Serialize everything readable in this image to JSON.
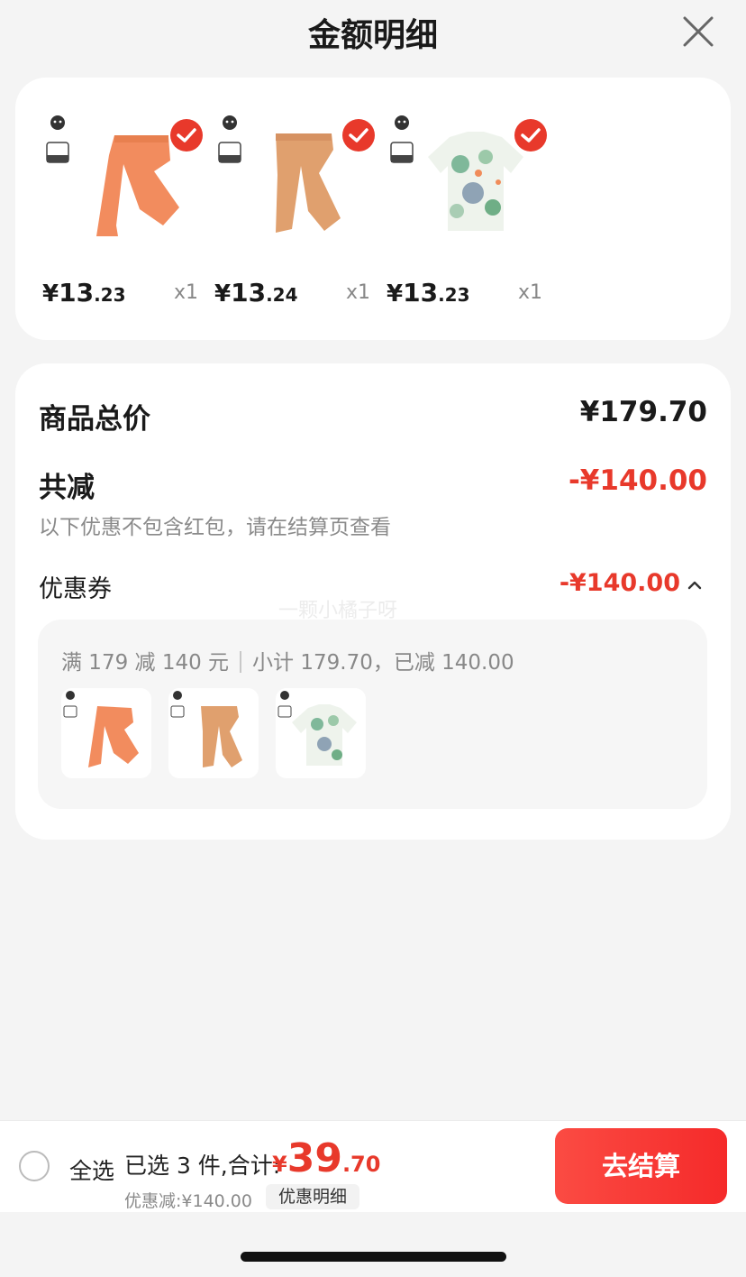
{
  "header": {
    "title": "金额明细"
  },
  "products": [
    {
      "price_yuan": "¥",
      "price_int": "13",
      "price_dec": ".23",
      "qty": "x1"
    },
    {
      "price_yuan": "¥",
      "price_int": "13",
      "price_dec": ".24",
      "qty": "x1"
    },
    {
      "price_yuan": "¥",
      "price_int": "13",
      "price_dec": ".23",
      "qty": "x1"
    }
  ],
  "summary": {
    "total_label": "商品总价",
    "total_value": "¥179.70",
    "reduce_label": "共减",
    "reduce_value": "-¥140.00",
    "note": "以下优惠不包含红包，请在结算页查看",
    "coupon_label": "优惠券",
    "coupon_value": "-¥140.00",
    "watermark": "一颗小橘子呀",
    "coupon_rule": "满 179 减 140 元",
    "coupon_detail": "小计 179.70，已减 140.00"
  },
  "bottom": {
    "select_all": "全选",
    "selected_prefix": "已选 3 件,合计:",
    "total_yuan": "¥",
    "total_int": "39",
    "total_dec": ".70",
    "discount": "优惠减:¥140.00",
    "detail_button": "优惠明细",
    "checkout_button": "去结算"
  },
  "colors": {
    "accent": "#e8392b",
    "pants_1": "#f28c5e",
    "pants_2": "#e0a06e"
  }
}
